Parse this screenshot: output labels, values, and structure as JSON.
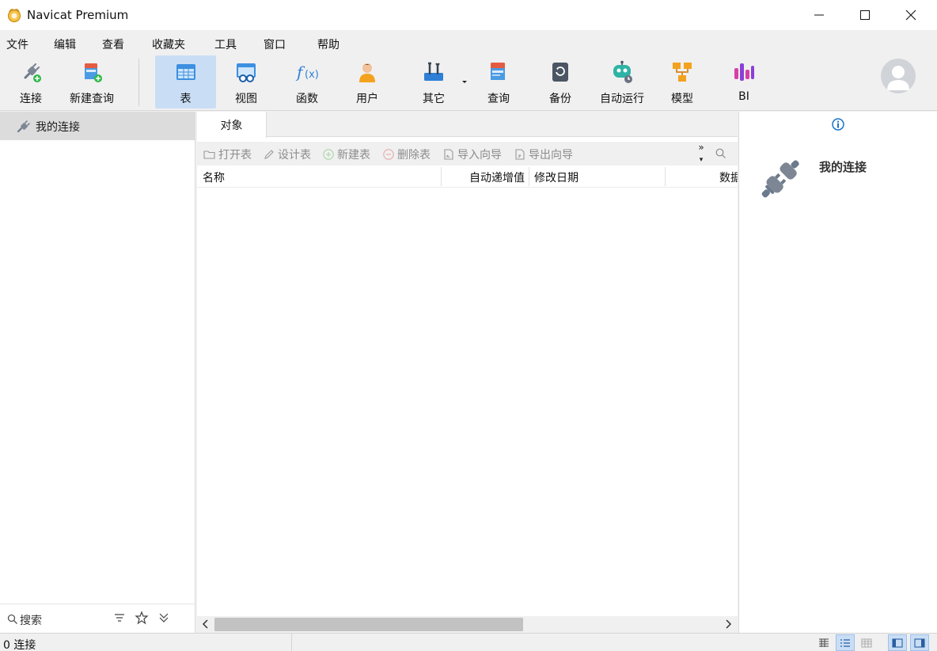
{
  "window": {
    "title": "Navicat Premium"
  },
  "menu": [
    "文件",
    "编辑",
    "查看",
    "收藏夹",
    "工具",
    "窗口",
    "帮助"
  ],
  "toolbar": {
    "connect": "连接",
    "new_query": "新建查询",
    "table": "表",
    "view": "视图",
    "function": "函数",
    "user": "用户",
    "other": "其它",
    "query": "查询",
    "backup": "备份",
    "automation": "自动运行",
    "model": "模型",
    "bi": "BI",
    "active": "表"
  },
  "sidebar": {
    "connections": [
      {
        "label": "我的连接"
      }
    ],
    "search_placeholder": "搜索"
  },
  "main": {
    "tab": "对象",
    "actions": {
      "open_table": "打开表",
      "design_table": "设计表",
      "new_table": "新建表",
      "delete_table": "删除表",
      "import_wizard": "导入向导",
      "export_wizard": "导出向导"
    },
    "more": "»",
    "columns": {
      "name": "名称",
      "auto_increment": "自动递增值",
      "modified": "修改日期",
      "data": "数据"
    },
    "rows": []
  },
  "info_panel": {
    "title": "我的连接"
  },
  "status": {
    "text": "0 连接"
  },
  "colors": {
    "active_toolbar": "#c9def5",
    "selected_item": "#dcdcdc",
    "info_blue": "#1a73c8"
  }
}
